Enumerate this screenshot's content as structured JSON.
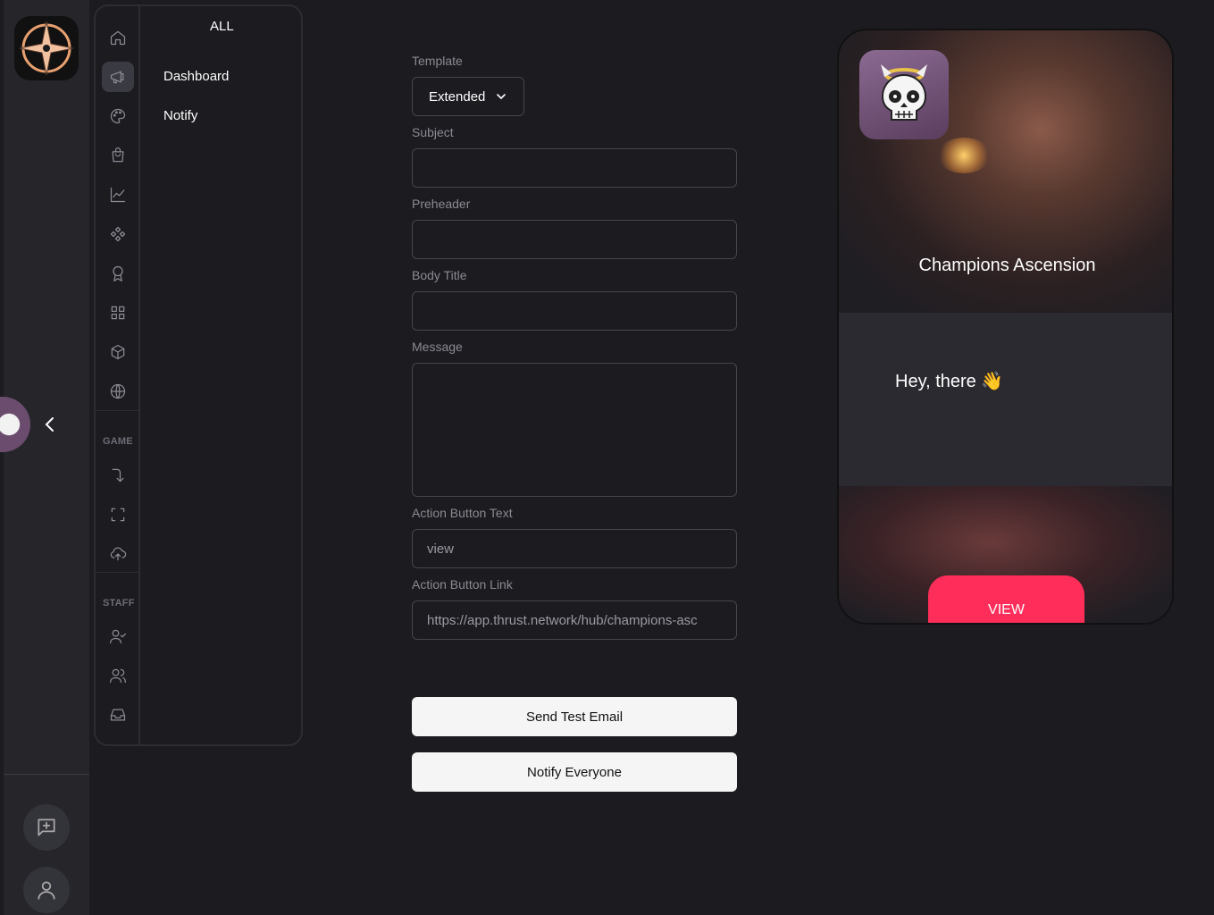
{
  "nav": {
    "all_label": "ALL",
    "menu_items": [
      "Dashboard",
      "Notify"
    ],
    "sections": {
      "game": "GAME",
      "staff": "STAFF"
    }
  },
  "form": {
    "template_label": "Template",
    "template_value": "Extended",
    "subject_label": "Subject",
    "subject_value": "",
    "preheader_label": "Preheader",
    "preheader_value": "",
    "body_title_label": "Body Title",
    "body_title_value": "",
    "message_label": "Message",
    "message_value": "",
    "action_button_text_label": "Action Button Text",
    "action_button_text_value": "view",
    "action_button_link_label": "Action Button Link",
    "action_button_link_value": "https://app.thrust.network/hub/champions-asc",
    "send_test_label": "Send Test Email",
    "notify_everyone_label": "Notify Everyone"
  },
  "preview": {
    "game_title": "Champions Ascension",
    "greeting": "Hey, there 👋",
    "button_label": "VIEW"
  },
  "colors": {
    "background": "#1c1b20",
    "accent": "#ff2d5a",
    "button_light": "#f5f5f5"
  }
}
